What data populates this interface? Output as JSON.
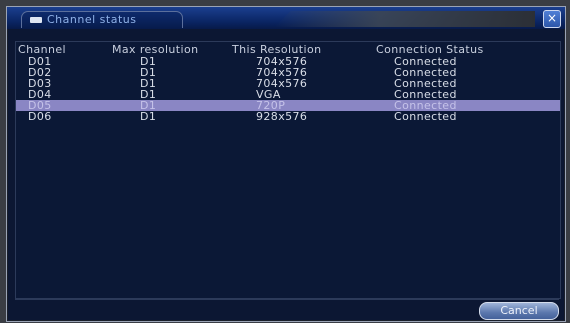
{
  "window": {
    "title": "Channel status"
  },
  "table": {
    "headers": [
      "Channel",
      "Max resolution",
      "This Resolution",
      "Connection Status"
    ],
    "rows": [
      [
        "D01",
        "D1",
        "704x576",
        "Connected"
      ],
      [
        "D02",
        "D1",
        "704x576",
        "Connected"
      ],
      [
        "D03",
        "D1",
        "704x576",
        "Connected"
      ],
      [
        "D04",
        "D1",
        "VGA",
        "Connected"
      ],
      [
        "D05",
        "D1",
        "720P",
        "Connected"
      ],
      [
        "D06",
        "D1",
        "928x576",
        "Connected"
      ]
    ],
    "selected_row": 4
  },
  "buttons": {
    "cancel": "Cancel",
    "close": "×"
  }
}
